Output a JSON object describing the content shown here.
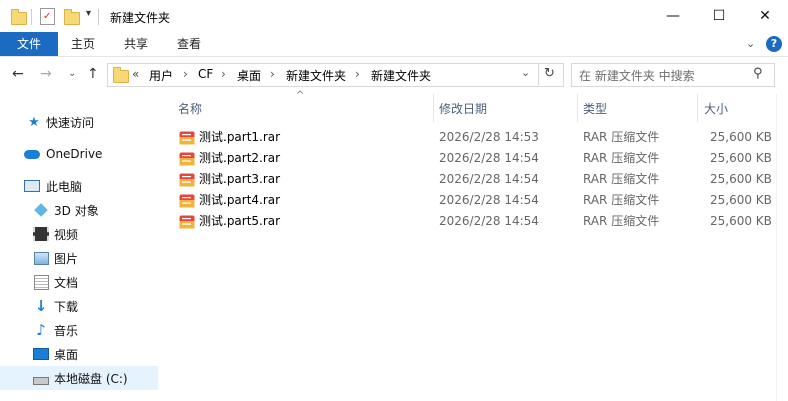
{
  "window": {
    "title": "新建文件夹",
    "minimize": "—",
    "maximize": "☐",
    "close": "✕"
  },
  "ribbon": {
    "tabs": [
      "文件",
      "主页",
      "共享",
      "查看"
    ],
    "help": "?"
  },
  "address": {
    "overflow": "«",
    "crumbs": [
      "用户",
      "CF",
      "桌面",
      "新建文件夹",
      "新建文件夹"
    ],
    "search_placeholder": "在 新建文件夹 中搜索"
  },
  "nav": {
    "quick_access": "快速访问",
    "onedrive": "OneDrive",
    "this_pc": "此电脑",
    "objects_3d": "3D 对象",
    "videos": "视频",
    "pictures": "图片",
    "documents": "文档",
    "downloads": "下载",
    "music": "音乐",
    "desktop": "桌面",
    "local_disk": "本地磁盘 (C:)"
  },
  "columns": {
    "name": "名称",
    "date": "修改日期",
    "type": "类型",
    "size": "大小"
  },
  "files": [
    {
      "name": "测试.part1.rar",
      "date": "2026/2/28 14:53",
      "type": "RAR 压缩文件",
      "size": "25,600 KB"
    },
    {
      "name": "测试.part2.rar",
      "date": "2026/2/28 14:54",
      "type": "RAR 压缩文件",
      "size": "25,600 KB"
    },
    {
      "name": "测试.part3.rar",
      "date": "2026/2/28 14:54",
      "type": "RAR 压缩文件",
      "size": "25,600 KB"
    },
    {
      "name": "测试.part4.rar",
      "date": "2026/2/28 14:54",
      "type": "RAR 压缩文件",
      "size": "25,600 KB"
    },
    {
      "name": "测试.part5.rar",
      "date": "2026/2/28 14:54",
      "type": "RAR 压缩文件",
      "size": "25,600 KB"
    }
  ],
  "colors": {
    "accent": "#1c6bc2",
    "header_text": "#4c607a",
    "selection": "#e5f3ff"
  }
}
